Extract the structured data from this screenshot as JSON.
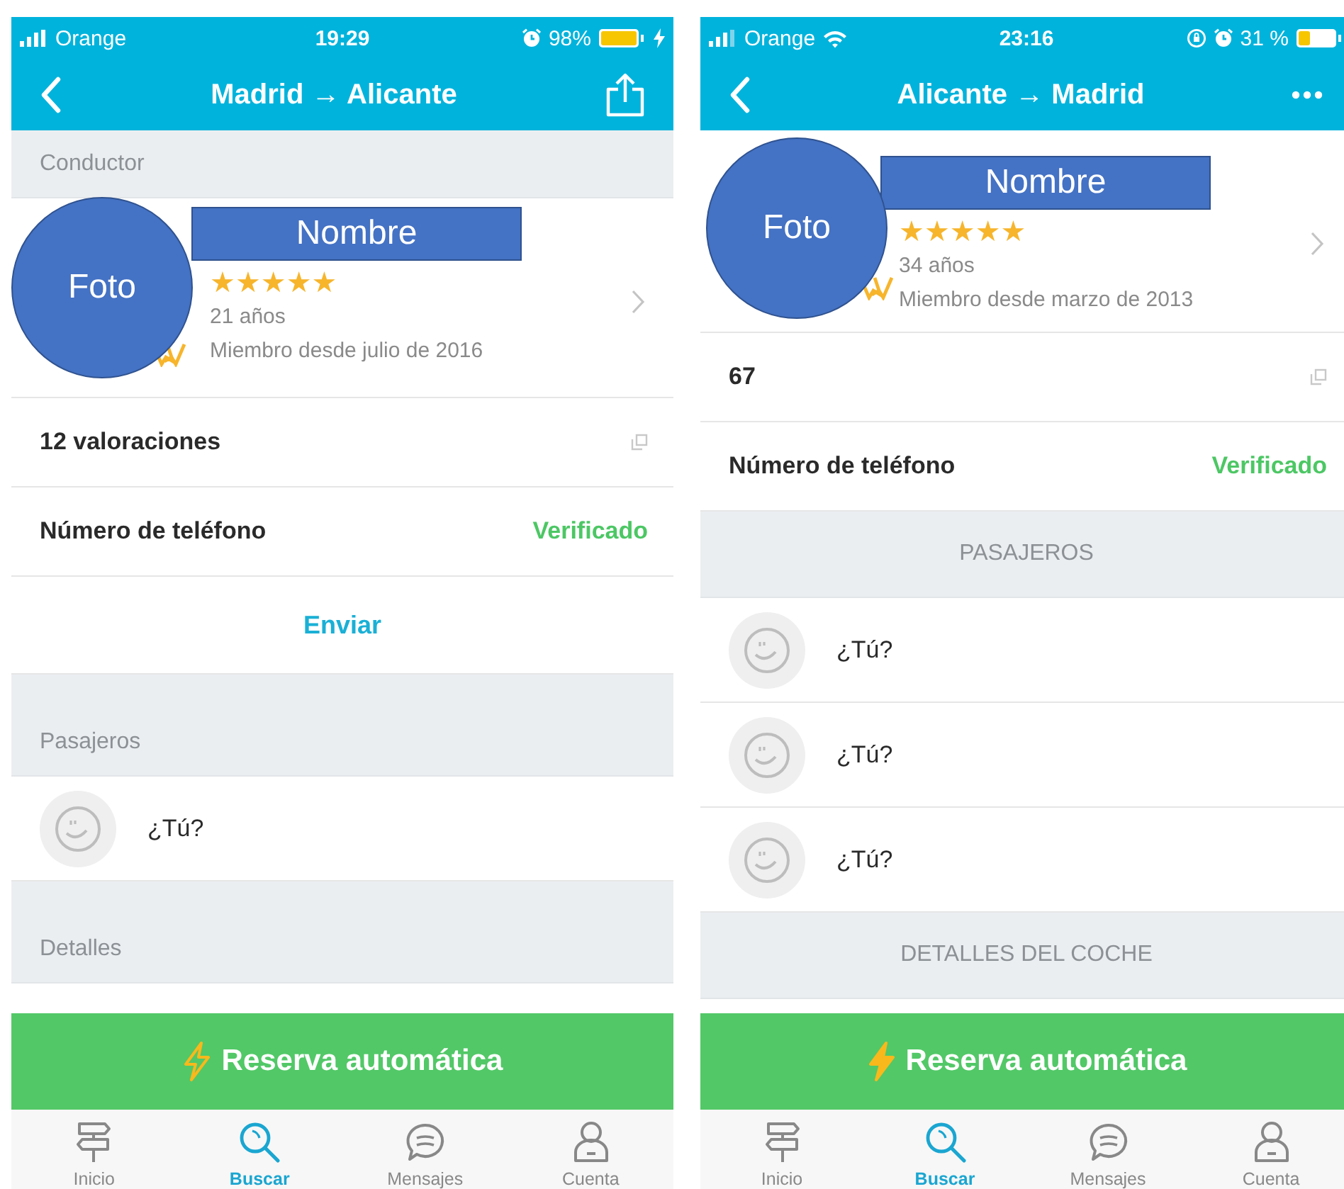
{
  "phones": [
    {
      "status": {
        "carrier": "Orange",
        "time": "19:29",
        "battery": "98%",
        "wifi": false,
        "rotation_lock": false,
        "charging": true,
        "low": false
      },
      "nav": {
        "title": "Madrid → Alicante",
        "kind": "share"
      },
      "sections": [
        {
          "kind": "header",
          "label": "Conductor",
          "tall": false,
          "centered": false
        },
        {
          "kind": "driver",
          "photo": "Foto",
          "name": "Nombre",
          "stars": 5,
          "age": "21 años",
          "member": "Miembro desde julio de 2016"
        },
        {
          "kind": "row",
          "label": "12 valoraciones",
          "copy": true
        },
        {
          "kind": "row",
          "label": "Número de teléfono",
          "value": "Verificado",
          "copy": false
        },
        {
          "kind": "action",
          "label": "Enviar"
        },
        {
          "kind": "header",
          "label": "Pasajeros",
          "tall": true,
          "centered": false
        },
        {
          "kind": "passenger",
          "label": "¿Tú?"
        },
        {
          "kind": "header",
          "label": "Detalles",
          "tall": true,
          "centered": false
        }
      ],
      "booking": {
        "label": "Reserva automática",
        "kind": "outline"
      },
      "tabs": [
        {
          "label": "Inicio",
          "selected": false
        },
        {
          "label": "Buscar",
          "selected": true
        },
        {
          "label": "Mensajes",
          "selected": false
        },
        {
          "label": "Cuenta",
          "selected": false
        }
      ]
    },
    {
      "status": {
        "carrier": "Orange",
        "time": "23:16",
        "battery": "31 %",
        "wifi": true,
        "rotation_lock": true,
        "charging": false,
        "low": true
      },
      "nav": {
        "title": "Alicante → Madrid",
        "kind": "more"
      },
      "sections": [
        {
          "kind": "driver",
          "photo": "Foto",
          "name": "Nombre",
          "stars": 5,
          "age": "34 años",
          "member": "Miembro desde marzo de 2013"
        },
        {
          "kind": "row",
          "label": "67",
          "copy": true
        },
        {
          "kind": "row",
          "label": "Número de teléfono",
          "value": "Verificado",
          "copy": false
        },
        {
          "kind": "header",
          "label": "PASAJEROS",
          "tall": false,
          "centered": true
        },
        {
          "kind": "passenger",
          "label": "¿Tú?"
        },
        {
          "kind": "passenger",
          "label": "¿Tú?"
        },
        {
          "kind": "passenger",
          "label": "¿Tú?"
        },
        {
          "kind": "header",
          "label": "DETALLES DEL COCHE",
          "tall": false,
          "centered": true
        }
      ],
      "booking": {
        "label": "Reserva automática",
        "kind": "filled"
      },
      "tabs": [
        {
          "label": "Inicio",
          "selected": false
        },
        {
          "label": "Buscar",
          "selected": true
        },
        {
          "label": "Mensajes",
          "selected": false
        },
        {
          "label": "Cuenta",
          "selected": false
        }
      ]
    }
  ]
}
